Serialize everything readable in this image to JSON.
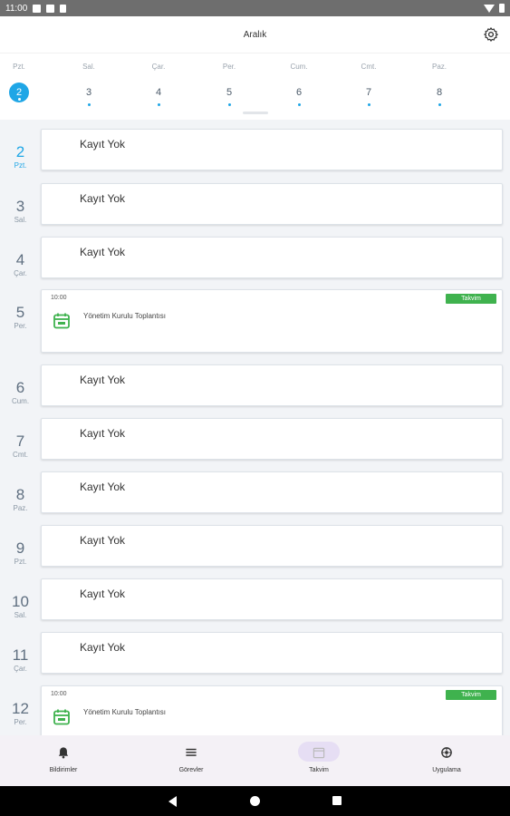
{
  "status_bar": {
    "time": "11:00"
  },
  "header": {
    "title": "Aralık",
    "settings_icon": "gear-icon"
  },
  "week": {
    "days": [
      {
        "name": "Pzt.",
        "num": "2",
        "active": true
      },
      {
        "name": "Sal.",
        "num": "3",
        "active": false
      },
      {
        "name": "Çar.",
        "num": "4",
        "active": false
      },
      {
        "name": "Per.",
        "num": "5",
        "active": false
      },
      {
        "name": "Cum.",
        "num": "6",
        "active": false
      },
      {
        "name": "Cmt.",
        "num": "7",
        "active": false
      },
      {
        "name": "Paz.",
        "num": "8",
        "active": false
      }
    ]
  },
  "agenda": {
    "empty_text": "Kayıt Yok",
    "days": [
      {
        "num": "2",
        "name": "Pzt.",
        "today": true,
        "events": []
      },
      {
        "num": "3",
        "name": "Sal.",
        "events": []
      },
      {
        "num": "4",
        "name": "Çar.",
        "events": []
      },
      {
        "num": "5",
        "name": "Per.",
        "events": [
          {
            "time": "10:00",
            "title": "Yönetim Kurulu Toplantısı",
            "tag": "Takvim"
          }
        ]
      },
      {
        "num": "6",
        "name": "Cum.",
        "events": []
      },
      {
        "num": "7",
        "name": "Cmt.",
        "events": []
      },
      {
        "num": "8",
        "name": "Paz.",
        "events": []
      },
      {
        "num": "9",
        "name": "Pzt.",
        "events": []
      },
      {
        "num": "10",
        "name": "Sal.",
        "events": []
      },
      {
        "num": "11",
        "name": "Çar.",
        "events": []
      },
      {
        "num": "12",
        "name": "Per.",
        "events": [
          {
            "time": "10:00",
            "title": "Yönetim Kurulu Toplantısı",
            "tag": "Takvim"
          }
        ]
      }
    ]
  },
  "bottom_nav": {
    "items": [
      {
        "label": "Bildirimler",
        "icon": "bell-icon",
        "active": false
      },
      {
        "label": "Görevler",
        "icon": "list-icon",
        "active": false
      },
      {
        "label": "Takvim",
        "icon": "calendar-icon",
        "active": true
      },
      {
        "label": "Uygulama",
        "icon": "app-icon",
        "active": false
      }
    ]
  },
  "colors": {
    "accent": "#1fa6e6",
    "tag_green": "#3fb24e",
    "nav_active": "#e6def4"
  }
}
